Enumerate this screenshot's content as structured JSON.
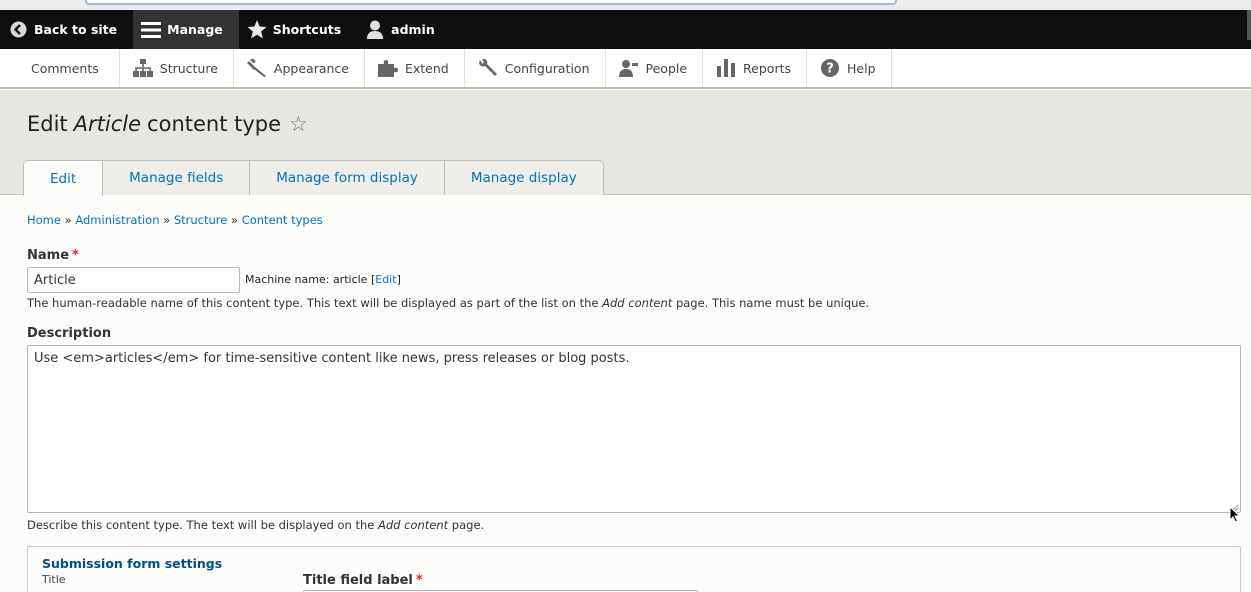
{
  "toolbar": {
    "back": "Back to site",
    "manage": "Manage",
    "shortcuts": "Shortcuts",
    "user": "admin"
  },
  "tray": [
    {
      "label": "Comments",
      "icon": ""
    },
    {
      "label": "Structure",
      "icon": "structure-icon"
    },
    {
      "label": "Appearance",
      "icon": "brush-icon"
    },
    {
      "label": "Extend",
      "icon": "puzzle-icon"
    },
    {
      "label": "Configuration",
      "icon": "wrench-icon"
    },
    {
      "label": "People",
      "icon": "people-icon"
    },
    {
      "label": "Reports",
      "icon": "bar-chart-icon"
    },
    {
      "label": "Help",
      "icon": "question-icon"
    }
  ],
  "page": {
    "title_prefix": "Edit",
    "title_type": "Article",
    "title_suffix": "content type",
    "tabs": [
      "Edit",
      "Manage fields",
      "Manage form display",
      "Manage display"
    ],
    "breadcrumb": [
      "Home",
      "Administration",
      "Structure",
      "Content types"
    ]
  },
  "form": {
    "name_label": "Name",
    "name_value": "Article",
    "machine_label": "Machine name: article",
    "machine_edit": "Edit",
    "name_help_1": "The human-readable name of this content type. This text will be displayed as part of the list on the",
    "name_help_em": "Add content",
    "name_help_2": "page. This name must be unique.",
    "description_label": "Description",
    "description_value": "Use <em>articles</em> for time-sensitive content like news, press releases or blog posts.",
    "desc_help_1": "Describe this content type. The text will be displayed on the",
    "desc_help_em": "Add content",
    "desc_help_2": "page.",
    "submission_title": "Submission form settings",
    "submission_sub": "Title",
    "title_field_label": "Title field label"
  },
  "colors": {
    "link": "#0074bd",
    "toolbar": "#0f0f0f",
    "required": "#e22"
  }
}
